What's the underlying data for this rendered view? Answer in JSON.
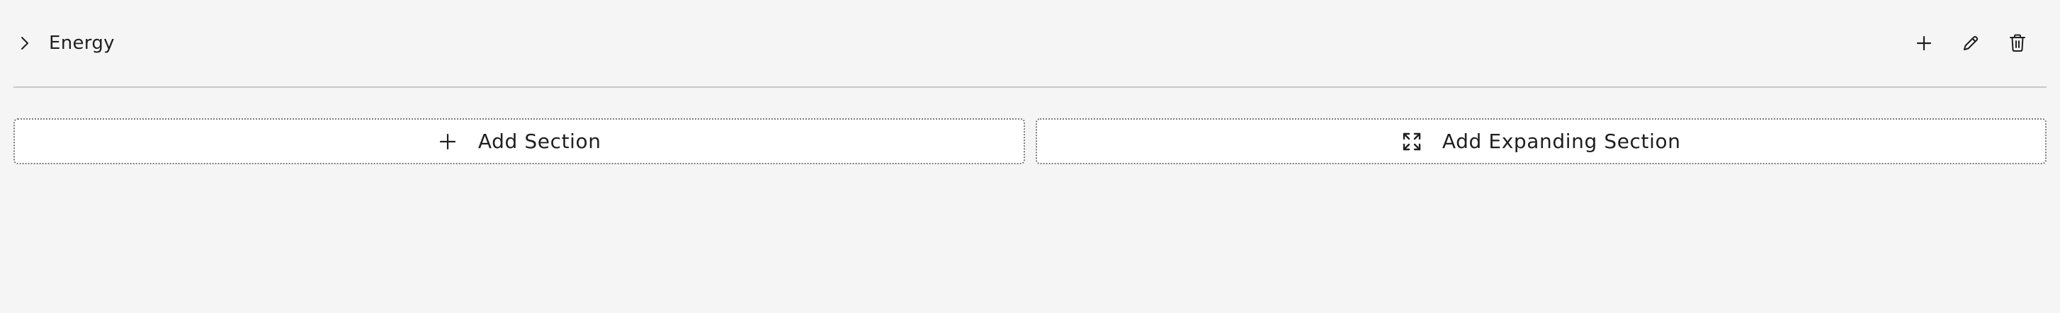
{
  "section": {
    "title": "Energy",
    "icons": {
      "toggle": "chevron-right-icon",
      "add": "plus-icon",
      "edit": "pencil-icon",
      "delete": "trash-icon"
    }
  },
  "add_buttons": {
    "add_section_label": "Add Section",
    "add_section_icon": "plus-icon",
    "add_expanding_label": "Add Expanding Section",
    "add_expanding_icon": "expand-arrows-icon"
  },
  "colors": {
    "background": "#f5f5f5",
    "text": "#1f1f1f",
    "divider": "#c9c9c9",
    "button_bg": "#ffffff",
    "button_border": "#7a7a7a"
  }
}
